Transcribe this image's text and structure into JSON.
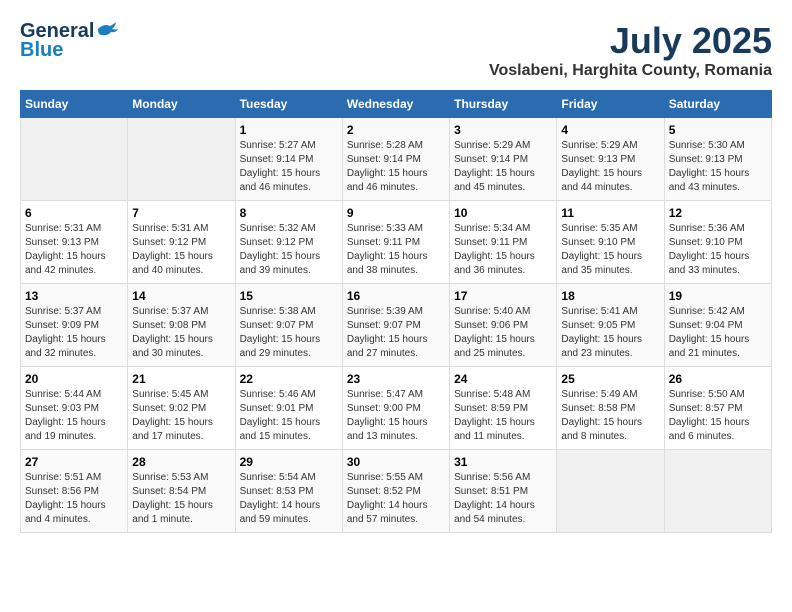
{
  "header": {
    "logo_general": "General",
    "logo_blue": "Blue",
    "month_title": "July 2025",
    "location": "Voslabeni, Harghita County, Romania"
  },
  "weekdays": [
    "Sunday",
    "Monday",
    "Tuesday",
    "Wednesday",
    "Thursday",
    "Friday",
    "Saturday"
  ],
  "weeks": [
    [
      {
        "day": "",
        "empty": true
      },
      {
        "day": "",
        "empty": true
      },
      {
        "day": "1",
        "sunrise": "5:27 AM",
        "sunset": "9:14 PM",
        "daylight": "15 hours and 46 minutes."
      },
      {
        "day": "2",
        "sunrise": "5:28 AM",
        "sunset": "9:14 PM",
        "daylight": "15 hours and 46 minutes."
      },
      {
        "day": "3",
        "sunrise": "5:29 AM",
        "sunset": "9:14 PM",
        "daylight": "15 hours and 45 minutes."
      },
      {
        "day": "4",
        "sunrise": "5:29 AM",
        "sunset": "9:13 PM",
        "daylight": "15 hours and 44 minutes."
      },
      {
        "day": "5",
        "sunrise": "5:30 AM",
        "sunset": "9:13 PM",
        "daylight": "15 hours and 43 minutes."
      }
    ],
    [
      {
        "day": "6",
        "sunrise": "5:31 AM",
        "sunset": "9:13 PM",
        "daylight": "15 hours and 42 minutes."
      },
      {
        "day": "7",
        "sunrise": "5:31 AM",
        "sunset": "9:12 PM",
        "daylight": "15 hours and 40 minutes."
      },
      {
        "day": "8",
        "sunrise": "5:32 AM",
        "sunset": "9:12 PM",
        "daylight": "15 hours and 39 minutes."
      },
      {
        "day": "9",
        "sunrise": "5:33 AM",
        "sunset": "9:11 PM",
        "daylight": "15 hours and 38 minutes."
      },
      {
        "day": "10",
        "sunrise": "5:34 AM",
        "sunset": "9:11 PM",
        "daylight": "15 hours and 36 minutes."
      },
      {
        "day": "11",
        "sunrise": "5:35 AM",
        "sunset": "9:10 PM",
        "daylight": "15 hours and 35 minutes."
      },
      {
        "day": "12",
        "sunrise": "5:36 AM",
        "sunset": "9:10 PM",
        "daylight": "15 hours and 33 minutes."
      }
    ],
    [
      {
        "day": "13",
        "sunrise": "5:37 AM",
        "sunset": "9:09 PM",
        "daylight": "15 hours and 32 minutes."
      },
      {
        "day": "14",
        "sunrise": "5:37 AM",
        "sunset": "9:08 PM",
        "daylight": "15 hours and 30 minutes."
      },
      {
        "day": "15",
        "sunrise": "5:38 AM",
        "sunset": "9:07 PM",
        "daylight": "15 hours and 29 minutes."
      },
      {
        "day": "16",
        "sunrise": "5:39 AM",
        "sunset": "9:07 PM",
        "daylight": "15 hours and 27 minutes."
      },
      {
        "day": "17",
        "sunrise": "5:40 AM",
        "sunset": "9:06 PM",
        "daylight": "15 hours and 25 minutes."
      },
      {
        "day": "18",
        "sunrise": "5:41 AM",
        "sunset": "9:05 PM",
        "daylight": "15 hours and 23 minutes."
      },
      {
        "day": "19",
        "sunrise": "5:42 AM",
        "sunset": "9:04 PM",
        "daylight": "15 hours and 21 minutes."
      }
    ],
    [
      {
        "day": "20",
        "sunrise": "5:44 AM",
        "sunset": "9:03 PM",
        "daylight": "15 hours and 19 minutes."
      },
      {
        "day": "21",
        "sunrise": "5:45 AM",
        "sunset": "9:02 PM",
        "daylight": "15 hours and 17 minutes."
      },
      {
        "day": "22",
        "sunrise": "5:46 AM",
        "sunset": "9:01 PM",
        "daylight": "15 hours and 15 minutes."
      },
      {
        "day": "23",
        "sunrise": "5:47 AM",
        "sunset": "9:00 PM",
        "daylight": "15 hours and 13 minutes."
      },
      {
        "day": "24",
        "sunrise": "5:48 AM",
        "sunset": "8:59 PM",
        "daylight": "15 hours and 11 minutes."
      },
      {
        "day": "25",
        "sunrise": "5:49 AM",
        "sunset": "8:58 PM",
        "daylight": "15 hours and 8 minutes."
      },
      {
        "day": "26",
        "sunrise": "5:50 AM",
        "sunset": "8:57 PM",
        "daylight": "15 hours and 6 minutes."
      }
    ],
    [
      {
        "day": "27",
        "sunrise": "5:51 AM",
        "sunset": "8:56 PM",
        "daylight": "15 hours and 4 minutes."
      },
      {
        "day": "28",
        "sunrise": "5:53 AM",
        "sunset": "8:54 PM",
        "daylight": "15 hours and 1 minute."
      },
      {
        "day": "29",
        "sunrise": "5:54 AM",
        "sunset": "8:53 PM",
        "daylight": "14 hours and 59 minutes."
      },
      {
        "day": "30",
        "sunrise": "5:55 AM",
        "sunset": "8:52 PM",
        "daylight": "14 hours and 57 minutes."
      },
      {
        "day": "31",
        "sunrise": "5:56 AM",
        "sunset": "8:51 PM",
        "daylight": "14 hours and 54 minutes."
      },
      {
        "day": "",
        "empty": true
      },
      {
        "day": "",
        "empty": true
      }
    ]
  ],
  "daylight_label": "Daylight: ",
  "sunrise_label": "Sunrise: ",
  "sunset_label": "Sunset: "
}
